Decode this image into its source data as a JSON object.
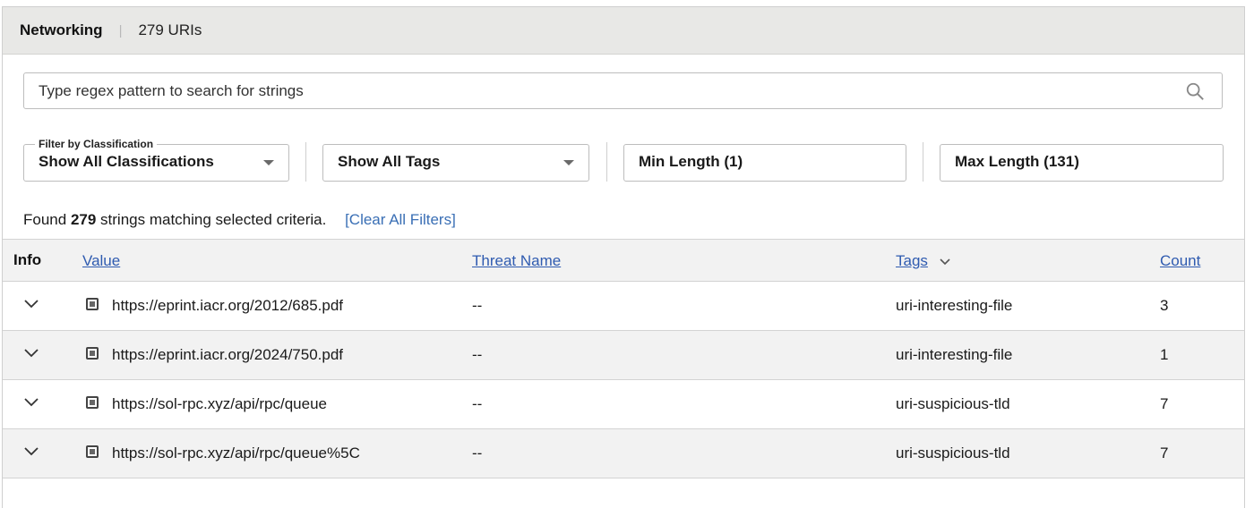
{
  "header": {
    "title": "Networking",
    "separator": "|",
    "count": "279 URIs"
  },
  "search": {
    "placeholder": "Type regex pattern to search for strings",
    "icon": "search-icon"
  },
  "filters": {
    "classification": {
      "label": "Filter by Classification",
      "value": "Show All Classifications"
    },
    "tags": {
      "value": "Show All Tags"
    },
    "min_length": {
      "value": "Min Length (1)"
    },
    "max_length": {
      "value": "Max Length (131)"
    }
  },
  "summary": {
    "prefix": "Found",
    "count": "279",
    "suffix": "strings matching selected criteria.",
    "clear_label": "[Clear All Filters]"
  },
  "table": {
    "columns": {
      "info": "Info",
      "value": "Value",
      "threat": "Threat Name",
      "tags": "Tags",
      "count": "Count"
    },
    "rows": [
      {
        "value": "https://eprint.iacr.org/2012/685.pdf",
        "threat": "--",
        "tag": "uri-interesting-file",
        "count": "3"
      },
      {
        "value": "https://eprint.iacr.org/2024/750.pdf",
        "threat": "--",
        "tag": "uri-interesting-file",
        "count": "1"
      },
      {
        "value": "https://sol-rpc.xyz/api/rpc/queue",
        "threat": "--",
        "tag": "uri-suspicious-tld",
        "count": "7"
      },
      {
        "value": "https://sol-rpc.xyz/api/rpc/queue%5C",
        "threat": "--",
        "tag": "uri-suspicious-tld",
        "count": "7"
      }
    ]
  },
  "colors": {
    "link": "#2f5bb0",
    "header_bg": "#e8e8e6",
    "row_alt": "#f2f2f2"
  }
}
